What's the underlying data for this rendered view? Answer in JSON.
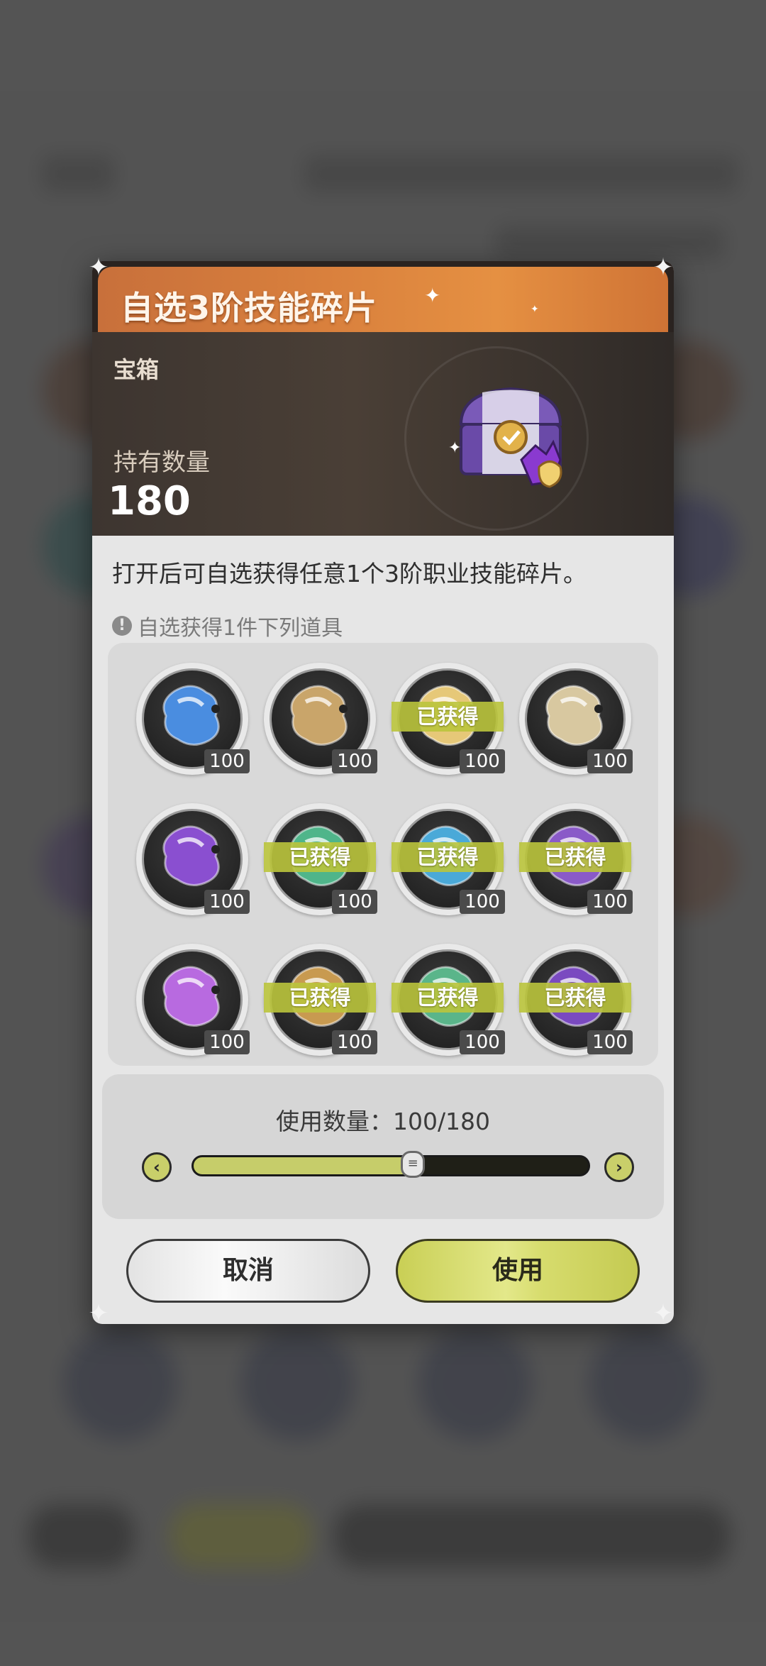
{
  "dialog": {
    "title": "自选3阶技能碎片",
    "item_type": "宝箱",
    "hold_label": "持有数量",
    "hold_value": "180",
    "description": "打开后可自选获得任意1个3阶职业技能碎片。",
    "hint": "自选获得1件下列道具"
  },
  "items": [
    {
      "count": "100",
      "badge": "",
      "color": "#4a8de0"
    },
    {
      "count": "100",
      "badge": "",
      "color": "#c9a56a"
    },
    {
      "count": "100",
      "badge": "已获得",
      "color": "#e6c878"
    },
    {
      "count": "100",
      "badge": "",
      "color": "#d8c8a0"
    },
    {
      "count": "100",
      "badge": "",
      "color": "#8a4fd0"
    },
    {
      "count": "100",
      "badge": "已获得",
      "color": "#4fb58a"
    },
    {
      "count": "100",
      "badge": "已获得",
      "color": "#4aa9d8"
    },
    {
      "count": "100",
      "badge": "已获得",
      "color": "#8a5ac8"
    },
    {
      "count": "100",
      "badge": "",
      "color": "#b86ae0"
    },
    {
      "count": "100",
      "badge": "已获得",
      "color": "#c89a50"
    },
    {
      "count": "100",
      "badge": "已获得",
      "color": "#5ab58a"
    },
    {
      "count": "100",
      "badge": "已获得",
      "color": "#7a4ac0"
    }
  ],
  "quantity": {
    "label": "使用数量：100/180",
    "value": 100,
    "max": 180
  },
  "buttons": {
    "cancel": "取消",
    "use": "使用"
  },
  "colors": {
    "accent": "#c9cf55",
    "title_bar": "#d9803d"
  }
}
